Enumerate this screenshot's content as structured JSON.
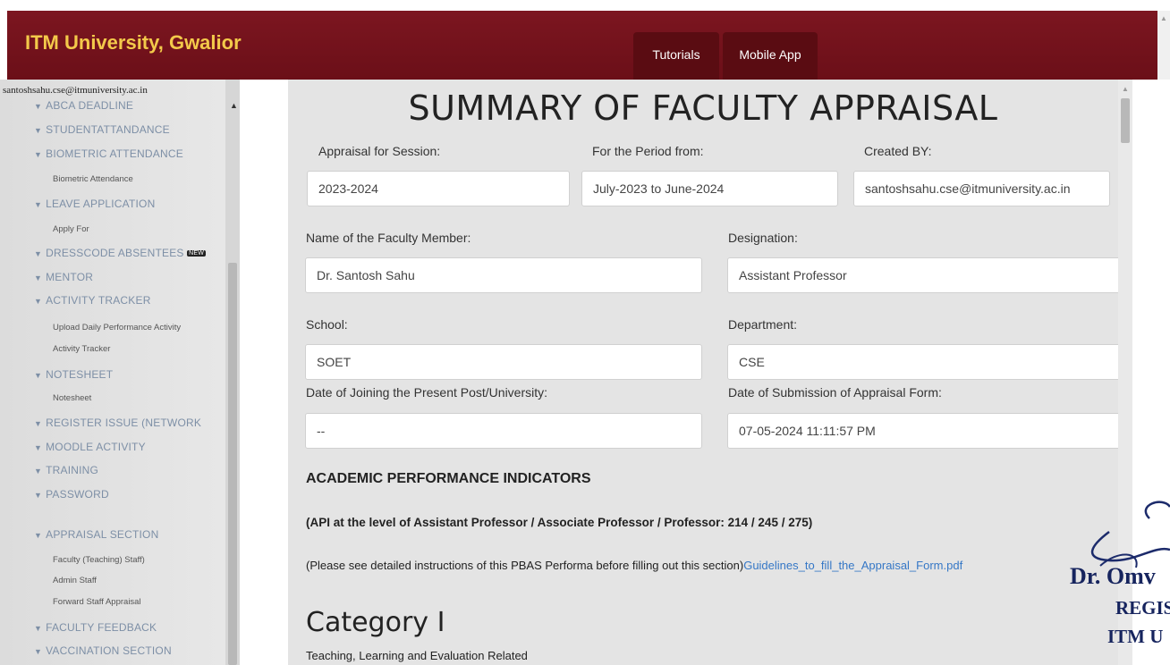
{
  "header": {
    "brand": "ITM University, Gwalior",
    "nav": [
      "Tutorials",
      "Mobile App"
    ]
  },
  "sidebar": {
    "user_email": "santoshsahu.cse@itmuniversity.ac.in",
    "menu": [
      {
        "label": "ABCA DEADLINE"
      },
      {
        "label": "STUDENTATTANDANCE"
      },
      {
        "label": "BIOMETRIC ATTENDANCE",
        "sub": [
          "Biometric Attendance"
        ]
      },
      {
        "label": "LEAVE APPLICATION",
        "sub": [
          "Apply For"
        ]
      },
      {
        "label": "DRESSCODE ABSENTEES",
        "badge": "NEW"
      },
      {
        "label": "MENTOR"
      },
      {
        "label": "ACTIVITY TRACKER",
        "sub": [
          "Upload Daily Performance Activity",
          "Activity Tracker"
        ]
      },
      {
        "label": "NOTESHEET",
        "sub": [
          "Notesheet"
        ]
      },
      {
        "label": "REGISTER ISSUE (NETWORK"
      },
      {
        "label": "MOODLE ACTIVITY"
      },
      {
        "label": "TRAINING"
      },
      {
        "label": "PASSWORD"
      },
      {
        "label": "APPRAISAL SECTION",
        "sub": [
          "Faculty (Teaching) Staff)",
          "Admin Staff",
          "Forward Staff Appraisal"
        ]
      },
      {
        "label": "FACULTY FEEDBACK"
      },
      {
        "label": "VACCINATION SECTION"
      }
    ]
  },
  "form": {
    "title": "SUMMARY OF FACULTY APPRAISAL",
    "session_label": "Appraisal for Session:",
    "session_value": "2023-2024",
    "period_label": "For the Period from:",
    "period_value": "July-2023 to June-2024",
    "created_label": "Created BY:",
    "created_value": "santoshsahu.cse@itmuniversity.ac.in",
    "name_label": "Name of the Faculty Member:",
    "name_value": "Dr. Santosh Sahu",
    "designation_label": "Designation:",
    "designation_value": "Assistant Professor",
    "school_label": "School:",
    "school_value": "SOET",
    "department_label": "Department:",
    "department_value": "CSE",
    "joining_label": "Date of Joining the Present Post/University:",
    "joining_value": "--",
    "submission_label": "Date of Submission of Appraisal Form:",
    "submission_value": "07-05-2024 11:11:57 PM",
    "section_heading": "ACADEMIC PERFORMANCE INDICATORS",
    "api_text": "(API at the level of Assistant Professor / Associate Professor / Professor: 214 / 245 / 275)",
    "note_text": "(Please see detailed instructions of this PBAS Performa before filling out this section)",
    "note_link": "Guidelines_to_fill_the_Appraisal_Form.pdf",
    "category_heading": "Category I",
    "category_sub": "Teaching, Learning and Evaluation Related"
  },
  "stamp": {
    "line1": "Dr. Omv",
    "line2": "REGIS",
    "line3": "ITM U"
  }
}
